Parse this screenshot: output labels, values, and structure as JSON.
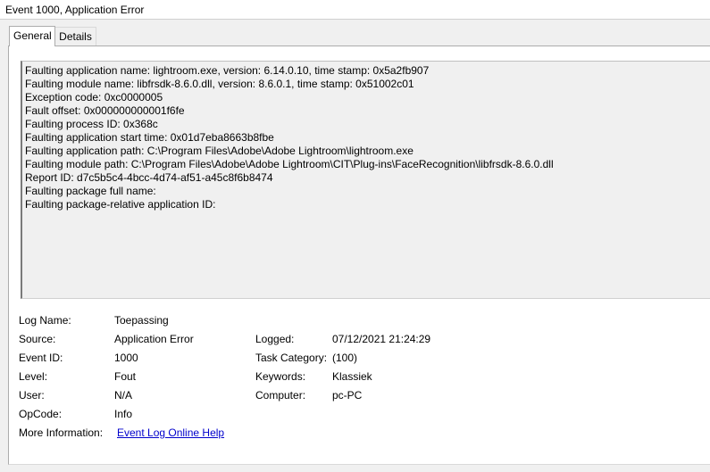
{
  "window": {
    "title": "Event 1000, Application Error"
  },
  "tabs": [
    {
      "label": "General",
      "selected": true
    },
    {
      "label": "Details",
      "selected": false
    }
  ],
  "description": [
    "Faulting application name: lightroom.exe, version: 6.14.0.10, time stamp: 0x5a2fb907",
    "Faulting module name: libfrsdk-8.6.0.dll, version: 8.6.0.1, time stamp: 0x51002c01",
    "Exception code: 0xc0000005",
    "Fault offset: 0x000000000001f6fe",
    "Faulting process ID: 0x368c",
    "Faulting application start time: 0x01d7eba8663b8fbe",
    "Faulting application path: C:\\Program Files\\Adobe\\Adobe Lightroom\\lightroom.exe",
    "Faulting module path: C:\\Program Files\\Adobe\\Adobe Lightroom\\CIT\\Plug-ins\\FaceRecognition\\libfrsdk-8.6.0.dll",
    "Report ID: d7c5b5c4-4bcc-4d74-af51-a45c8f6b8474",
    "Faulting package full name:",
    "Faulting package-relative application ID:"
  ],
  "details": {
    "log_name": {
      "label": "Log Name:",
      "value": "Toepassing"
    },
    "source": {
      "label": "Source:",
      "value": "Application Error"
    },
    "event_id": {
      "label": "Event ID:",
      "value": "1000"
    },
    "level": {
      "label": "Level:",
      "value": "Fout"
    },
    "user": {
      "label": "User:",
      "value": "N/A"
    },
    "opcode": {
      "label": "OpCode:",
      "value": "Info"
    },
    "more_info": {
      "label": "More Information:",
      "value": "Event Log Online Help"
    },
    "logged": {
      "label": "Logged:",
      "value": "07/12/2021 21:24:29"
    },
    "task_category": {
      "label": "Task Category:",
      "value": "(100)"
    },
    "keywords": {
      "label": "Keywords:",
      "value": "Klassiek"
    },
    "computer": {
      "label": "Computer:",
      "value": "pc-PC"
    }
  }
}
